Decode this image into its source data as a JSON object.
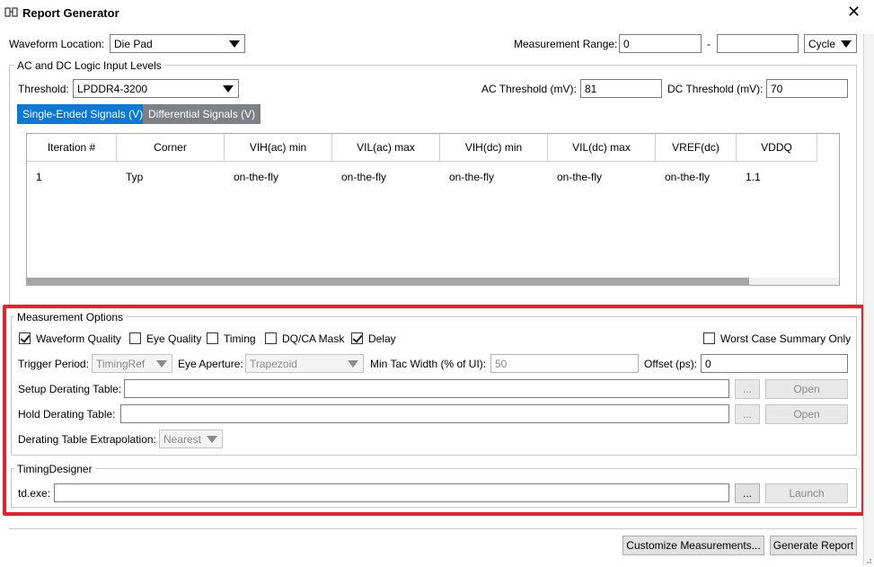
{
  "window": {
    "title": "Report Generator",
    "close_glyph": "✕"
  },
  "top": {
    "waveform_location_label": "Waveform Location:",
    "waveform_location_value": "Die Pad",
    "measurement_range_label": "Measurement Range:",
    "range_start": "0",
    "range_dash": "-",
    "range_end": "",
    "range_unit": "Cycle"
  },
  "ac_dc": {
    "legend": "AC and DC Logic Input Levels",
    "threshold_label": "Threshold:",
    "threshold_value": "LPDDR4-3200",
    "ac_threshold_label": "AC Threshold (mV):",
    "ac_threshold_value": "81",
    "dc_threshold_label": "DC Threshold (mV):",
    "dc_threshold_value": "70",
    "tabs": [
      {
        "label": "Single-Ended Signals (V)",
        "active": true
      },
      {
        "label": "Differential Signals (V)",
        "active": false
      }
    ],
    "table": {
      "columns": [
        "Iteration #",
        "Corner",
        "VIH(ac) min",
        "VIL(ac) max",
        "VIH(dc) min",
        "VIL(dc) max",
        "VREF(dc)",
        "VDDQ"
      ],
      "rows": [
        [
          "1",
          "Typ",
          "on-the-fly",
          "on-the-fly",
          "on-the-fly",
          "on-the-fly",
          "on-the-fly",
          "1.1"
        ]
      ]
    }
  },
  "measurement_options": {
    "legend": "Measurement Options",
    "checks": [
      {
        "label": "Waveform Quality",
        "checked": true
      },
      {
        "label": "Eye Quality",
        "checked": false
      },
      {
        "label": "Timing",
        "checked": false
      },
      {
        "label": "DQ/CA Mask",
        "checked": false
      },
      {
        "label": "Delay",
        "checked": true
      }
    ],
    "worst_case": {
      "label": "Worst Case Summary Only",
      "checked": false
    },
    "trigger_period_label": "Trigger Period:",
    "trigger_period_value": "TimingRef",
    "eye_aperture_label": "Eye Aperture:",
    "eye_aperture_value": "Trapezoid",
    "min_tac_label": "Min Tac Width (% of UI):",
    "min_tac_value": "50",
    "offset_label": "Offset (ps):",
    "offset_value": "0",
    "setup_table_label": "Setup Derating Table:",
    "setup_table_value": "",
    "hold_table_label": "Hold Derating Table:",
    "hold_table_value": "",
    "browse_label": "...",
    "open_label": "Open",
    "extrapolation_label": "Derating Table Extrapolation:",
    "extrapolation_value": "Nearest"
  },
  "timing_designer": {
    "legend": "TimingDesigner",
    "td_label": "td.exe:",
    "td_value": "",
    "browse_label": "...",
    "launch_label": "Launch"
  },
  "footer": {
    "customize_label": "Customize Measurements...",
    "generate_label": "Generate Report"
  },
  "colors": {
    "highlight_frame": "#e8212b",
    "tab_active": "#0a78d7",
    "tab_inactive": "#7d8187"
  }
}
